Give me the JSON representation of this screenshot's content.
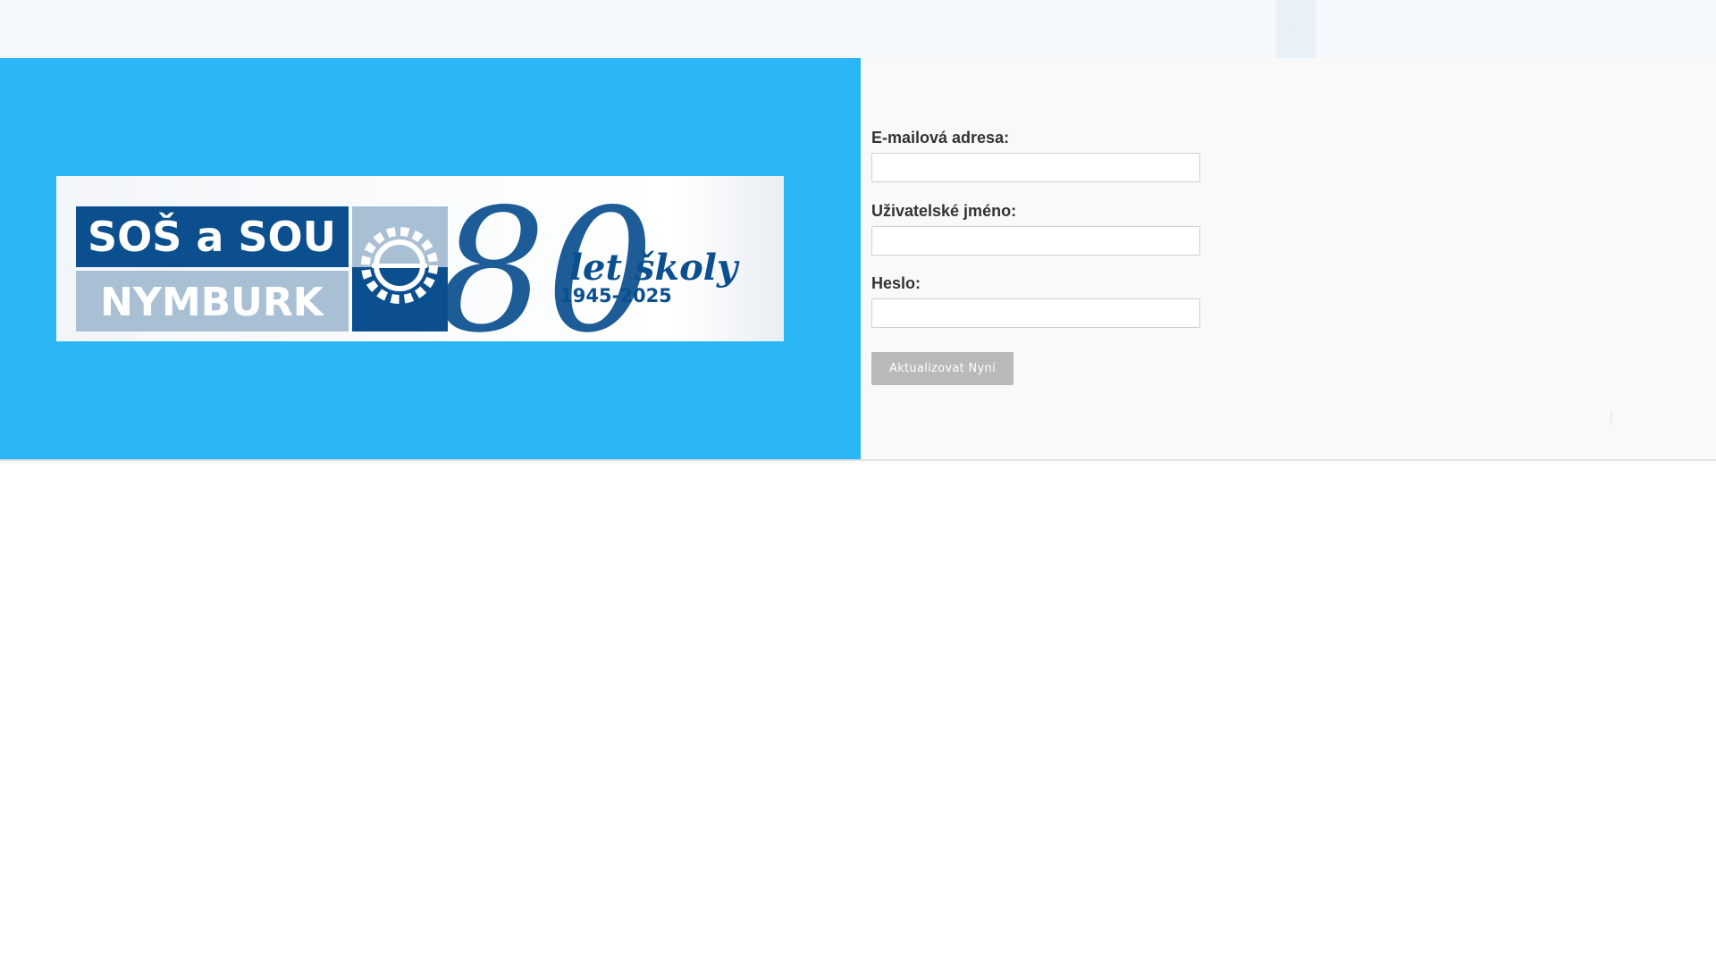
{
  "form": {
    "email_label": "E-mailová adresa:",
    "email_value": "",
    "username_label": "Uživatelské jméno:",
    "username_value": "",
    "password_label": "Heslo:",
    "password_value": "",
    "submit_label": "Aktualizovat Nyní"
  },
  "logo": {
    "line1": "SOŠ a SOU",
    "line2": "NYMBURK",
    "number": "80",
    "anniversary": "let školy",
    "years": "1945-2025"
  },
  "colors": {
    "hero_background": "#2bb6f6",
    "panel_background": "#f9f9f9",
    "brand_blue": "#0b4f8f",
    "brand_light": "#a9c0d4",
    "button_background": "#b9b9b9"
  },
  "icons": {
    "top_tab": "chevron-icon",
    "logo_emblem": "gear-icon"
  }
}
